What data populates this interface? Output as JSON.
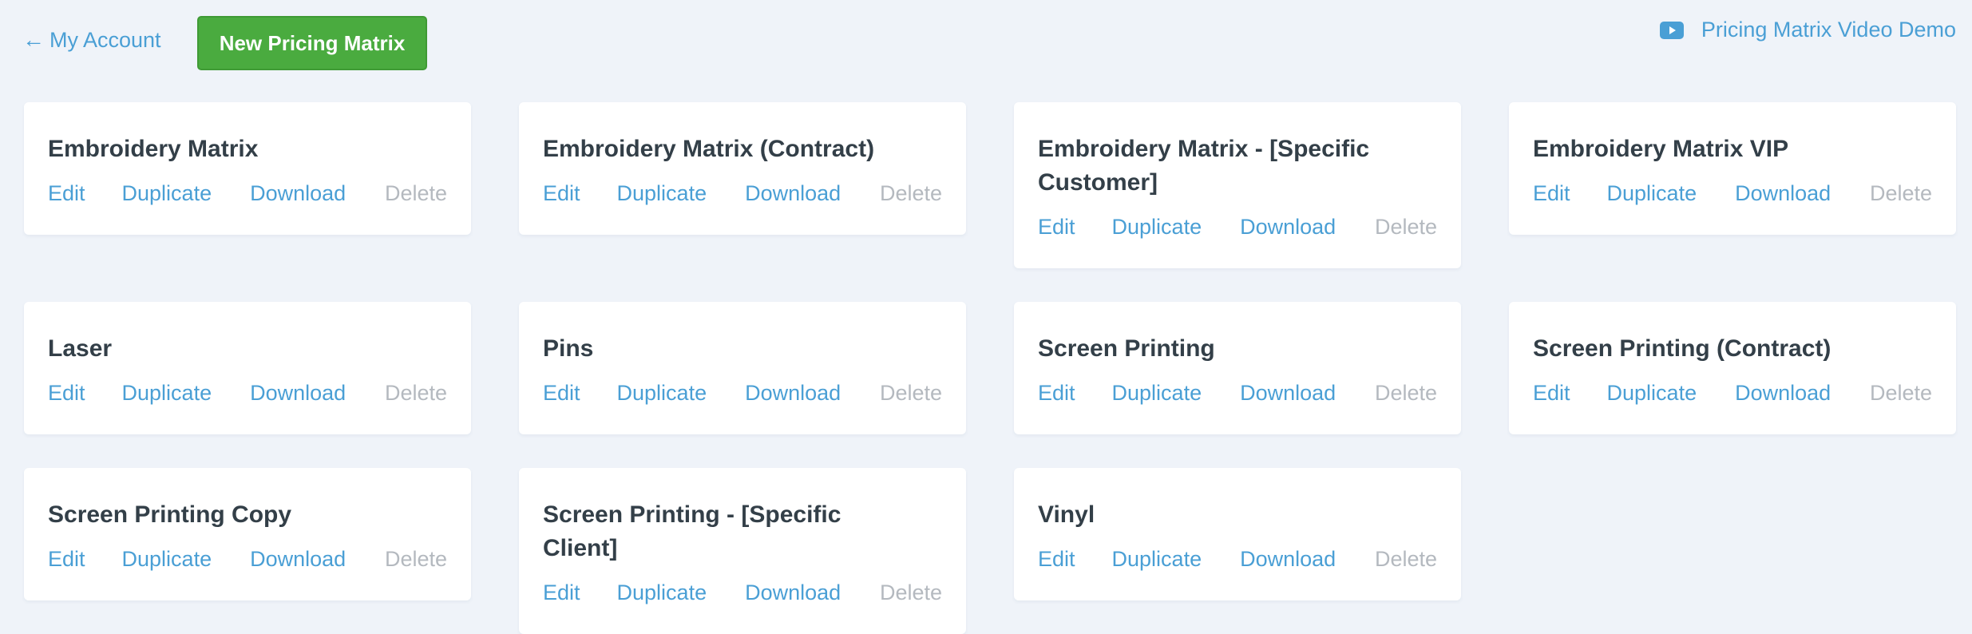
{
  "header": {
    "back_arrow": "←",
    "back_label": "My Account",
    "new_button_label": "New Pricing Matrix",
    "video_link_label": "Pricing Matrix Video Demo",
    "video_icon": "youtube-play-icon"
  },
  "colors": {
    "background": "#eff3f9",
    "link": "#4a9fd5",
    "primary_button": "#4aab3f",
    "title_text": "#333f48",
    "delete_disabled": "#b4b9bf"
  },
  "actions": {
    "edit": "Edit",
    "duplicate": "Duplicate",
    "download": "Download",
    "delete": "Delete"
  },
  "matrices": [
    {
      "title": "Embroidery Matrix"
    },
    {
      "title": "Embroidery Matrix (Contract)"
    },
    {
      "title": "Embroidery Matrix - [Specific Customer]"
    },
    {
      "title": "Embroidery Matrix VIP"
    },
    {
      "title": "Laser"
    },
    {
      "title": "Pins"
    },
    {
      "title": "Screen Printing"
    },
    {
      "title": "Screen Printing (Contract)"
    },
    {
      "title": "Screen Printing Copy"
    },
    {
      "title": "Screen Printing - [Specific Client]"
    },
    {
      "title": "Vinyl"
    }
  ]
}
